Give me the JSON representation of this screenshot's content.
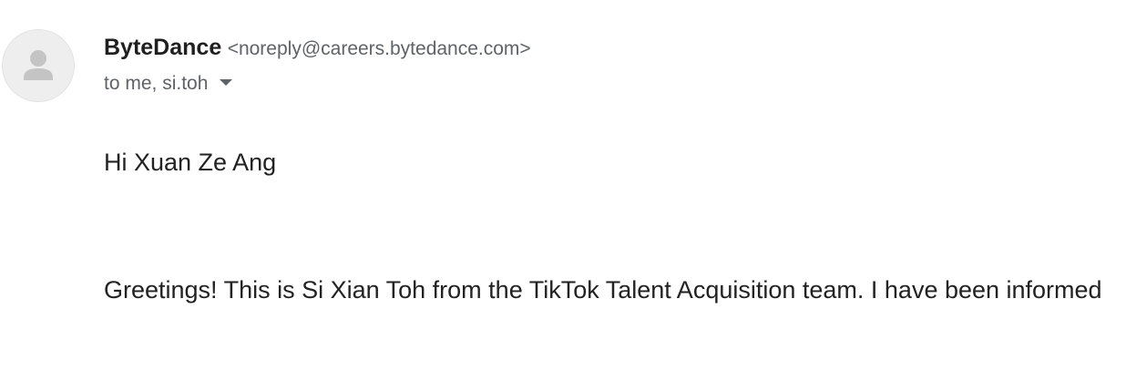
{
  "sender": {
    "name": "ByteDance",
    "email": "<noreply@careers.bytedance.com>",
    "avatar_icon": "person-icon"
  },
  "recipients": {
    "text": "to me, si.toh",
    "toggle_icon": "caret-down-icon"
  },
  "body": {
    "greeting": "Hi Xuan Ze Ang",
    "paragraph": "Greetings! This is Si Xian Toh from the TikTok Talent Acquisition team. I have been informed"
  },
  "colors": {
    "sender_name": "#1f1f1f",
    "secondary_text": "#5f6368",
    "body_text": "#222222",
    "avatar_bg": "#eeeeee",
    "avatar_glyph": "#c4c4c4"
  }
}
